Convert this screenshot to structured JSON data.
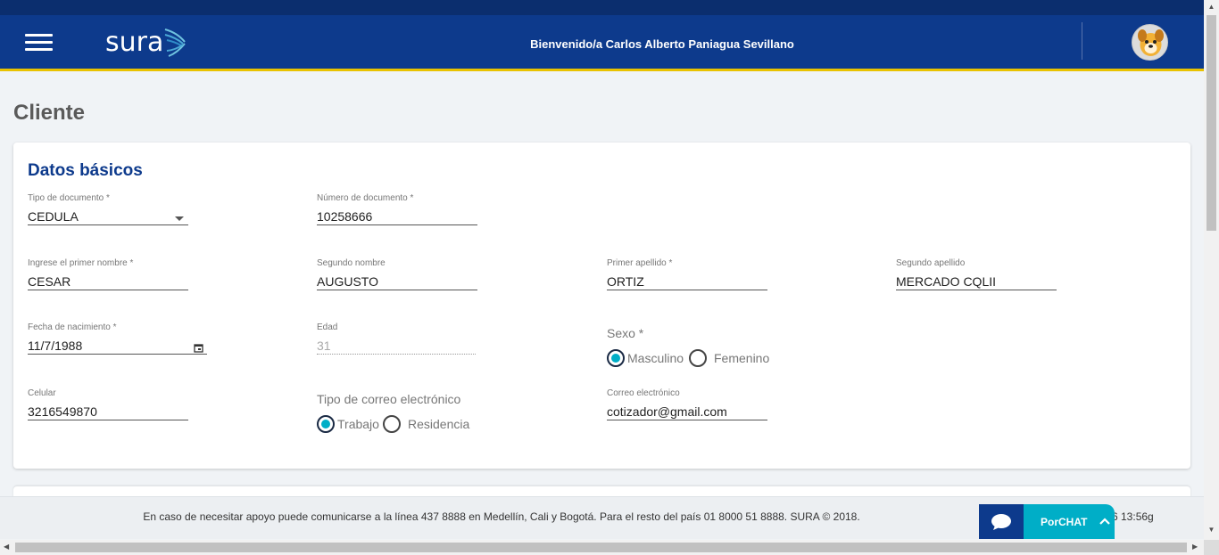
{
  "header": {
    "logo_text": "sura",
    "welcome": "Bienvenido/a Carlos Alberto Paniagua Sevillano",
    "colors": {
      "primary": "#0d3a8c",
      "accent_line": "#e9c200"
    }
  },
  "page": {
    "title": "Cliente"
  },
  "basic_data": {
    "title": "Datos básicos",
    "tipo_documento": {
      "label": "Tipo de documento *",
      "value": "CEDULA"
    },
    "numero_documento": {
      "label": "Número de documento *",
      "value": "10258666"
    },
    "primer_nombre": {
      "label": "Ingrese el primer nombre *",
      "value": "CESAR"
    },
    "segundo_nombre": {
      "label": "Segundo nombre",
      "value": "AUGUSTO"
    },
    "primer_apellido": {
      "label": "Primer apellido *",
      "value": "ORTIZ"
    },
    "segundo_apellido": {
      "label": "Segundo apellido",
      "value": "MERCADO CQLII"
    },
    "fecha_nacimiento": {
      "label": "Fecha de nacimiento *",
      "value": "11/7/1988"
    },
    "edad": {
      "label": "Edad",
      "value": "31"
    },
    "sexo": {
      "label": "Sexo *",
      "options": [
        "Masculino",
        "Femenino"
      ],
      "selected": "Masculino"
    },
    "celular": {
      "label": "Celular",
      "value": "3216549870"
    },
    "tipo_correo": {
      "label": "Tipo de correo electrónico",
      "options": [
        "Trabajo",
        "Residencia"
      ],
      "selected": "Trabajo"
    },
    "correo": {
      "label": "Correo electrónico",
      "value": "cotizador@gmail.com"
    }
  },
  "footer": {
    "text": "En caso de necesitar apoyo puede comunicarse a la línea 437 8888 en Medellín, Cali y Bogotá. Para el resto del país 01 8000 51 8888. SURA © 2018.",
    "time": "6 13:56g"
  },
  "chat": {
    "label": "PorCHAT",
    "accent": "#00aec7"
  }
}
